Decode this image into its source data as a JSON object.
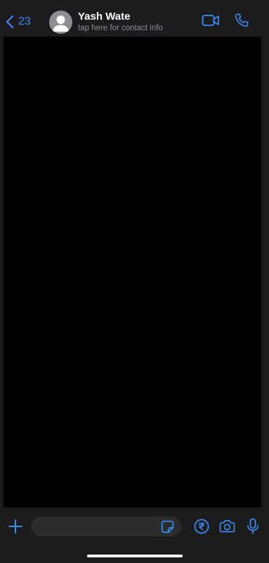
{
  "header": {
    "back_count": "23",
    "contact_name": "Yash Wate",
    "contact_subtitle": "tap here for contact info"
  },
  "footer": {
    "message_placeholder": "",
    "message_value": ""
  },
  "icons": {
    "back": "chevron-left-icon",
    "avatar": "default-avatar-icon",
    "video": "video-camera-icon",
    "phone": "phone-icon",
    "attach": "plus-icon",
    "sticker": "sticker-icon",
    "payment": "rupee-icon",
    "camera": "camera-icon",
    "mic": "microphone-icon"
  },
  "colors": {
    "accent": "#3a8ef6",
    "bar_background": "#1c1c1e",
    "chat_background": "#000000",
    "input_background": "#2c2c2e"
  }
}
